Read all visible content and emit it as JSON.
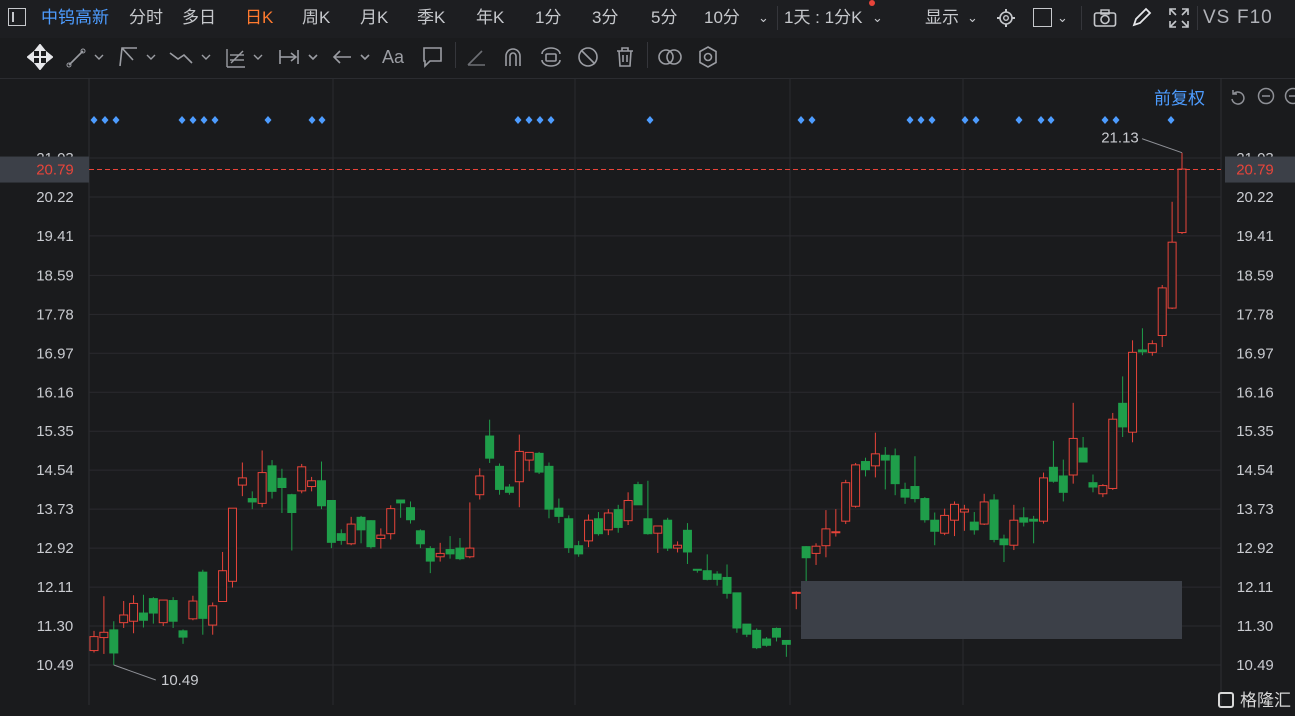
{
  "header": {
    "stock_name": "中钨高新",
    "period_tabs": [
      "分时",
      "多日",
      "日K",
      "周K",
      "月K",
      "季K",
      "年K",
      "1分",
      "3分",
      "5分",
      "10分"
    ],
    "active_tab": "日K",
    "period_select": "1天 : 1分K",
    "display_label": "显示",
    "vs_label": "VS",
    "f10_label": "F10"
  },
  "chart_header": {
    "adjust_label": "前复权"
  },
  "colors": {
    "up": "#e8443a",
    "down": "#1f9e4a",
    "active_tab": "#ff7a2f",
    "accent_blue": "#4d9cff",
    "price_line": "#e8443a"
  },
  "chart_data": {
    "type": "candlestick",
    "y_ticks": [
      "21.03",
      "20.22",
      "19.41",
      "18.59",
      "17.78",
      "16.97",
      "16.16",
      "15.35",
      "14.54",
      "13.73",
      "12.92",
      "12.11",
      "11.30",
      "10.49"
    ],
    "ylim": [
      10.49,
      21.03
    ],
    "current_price": "20.79",
    "high_label": "21.13",
    "low_label": "10.49",
    "candles": [
      [
        10.79,
        11.08,
        10.75,
        11.2
      ],
      [
        11.06,
        11.17,
        10.72,
        11.92
      ],
      [
        11.22,
        10.74,
        10.49,
        11.4
      ],
      [
        11.37,
        11.53,
        11.26,
        11.82
      ],
      [
        11.4,
        11.77,
        11.15,
        11.94
      ],
      [
        11.57,
        11.42,
        11.27,
        11.95
      ],
      [
        11.87,
        11.57,
        11.35,
        11.9
      ],
      [
        11.37,
        11.84,
        11.3,
        11.84
      ],
      [
        11.83,
        11.4,
        11.26,
        11.9
      ],
      [
        11.2,
        11.07,
        10.93,
        11.23
      ],
      [
        11.45,
        11.82,
        11.42,
        11.93
      ],
      [
        12.42,
        11.46,
        11.12,
        12.47
      ],
      [
        11.32,
        11.72,
        11.12,
        11.79
      ],
      [
        11.81,
        12.45,
        11.81,
        12.84
      ],
      [
        12.23,
        13.75,
        12.1,
        13.75
      ],
      [
        14.23,
        14.38,
        14.0,
        14.7
      ],
      [
        13.95,
        13.88,
        13.73,
        14.1
      ],
      [
        13.85,
        14.49,
        13.77,
        14.95
      ],
      [
        14.63,
        14.1,
        13.95,
        14.75
      ],
      [
        14.37,
        14.18,
        13.65,
        14.57
      ],
      [
        14.03,
        13.66,
        12.87,
        14.05
      ],
      [
        14.11,
        14.61,
        14.06,
        14.67
      ],
      [
        14.2,
        14.32,
        14.1,
        14.4
      ],
      [
        14.32,
        13.8,
        13.73,
        14.72
      ],
      [
        13.91,
        13.04,
        12.92,
        13.92
      ],
      [
        13.22,
        13.08,
        12.99,
        13.31
      ],
      [
        13.01,
        13.42,
        12.98,
        13.57
      ],
      [
        13.56,
        13.3,
        13.02,
        13.59
      ],
      [
        13.49,
        12.95,
        12.91,
        13.5
      ],
      [
        13.12,
        13.19,
        12.91,
        13.33
      ],
      [
        13.22,
        13.74,
        13.1,
        13.81
      ],
      [
        13.92,
        13.86,
        13.55,
        13.92
      ],
      [
        13.76,
        13.51,
        13.43,
        13.89
      ],
      [
        13.28,
        13.01,
        12.92,
        13.31
      ],
      [
        12.91,
        12.65,
        12.4,
        12.96
      ],
      [
        12.74,
        12.81,
        12.64,
        13.03
      ],
      [
        12.89,
        12.8,
        12.7,
        13.17
      ],
      [
        12.92,
        12.7,
        12.67,
        13.13
      ],
      [
        12.74,
        12.92,
        12.71,
        13.87
      ],
      [
        14.03,
        14.42,
        13.93,
        14.58
      ],
      [
        15.25,
        14.79,
        14.69,
        15.59
      ],
      [
        14.62,
        14.14,
        14.03,
        14.68
      ],
      [
        14.19,
        14.08,
        14.03,
        14.25
      ],
      [
        14.3,
        14.93,
        13.77,
        15.28
      ],
      [
        14.75,
        14.91,
        14.52,
        14.91
      ],
      [
        14.89,
        14.5,
        14.46,
        14.92
      ],
      [
        14.62,
        13.73,
        13.54,
        14.7
      ],
      [
        13.75,
        13.58,
        13.44,
        13.95
      ],
      [
        13.53,
        12.93,
        12.82,
        13.6
      ],
      [
        12.97,
        12.8,
        12.74,
        13.07
      ],
      [
        13.07,
        13.5,
        12.94,
        13.62
      ],
      [
        13.53,
        13.22,
        13.18,
        13.67
      ],
      [
        13.3,
        13.65,
        13.19,
        13.73
      ],
      [
        13.72,
        13.35,
        13.24,
        13.82
      ],
      [
        13.49,
        13.91,
        13.4,
        14.08
      ],
      [
        14.24,
        13.82,
        13.82,
        14.3
      ],
      [
        13.53,
        13.22,
        13.2,
        14.32
      ],
      [
        13.23,
        13.38,
        12.82,
        13.39
      ],
      [
        13.5,
        12.92,
        12.86,
        13.55
      ],
      [
        12.92,
        12.98,
        12.83,
        13.06
      ],
      [
        13.29,
        12.84,
        12.59,
        13.44
      ],
      [
        12.48,
        12.46,
        12.41,
        12.47
      ],
      [
        12.45,
        12.27,
        12.25,
        12.79
      ],
      [
        12.38,
        12.27,
        12.14,
        12.44
      ],
      [
        12.31,
        11.98,
        11.87,
        12.58
      ],
      [
        11.99,
        11.26,
        11.16,
        11.99
      ],
      [
        11.34,
        11.13,
        11.07,
        11.29
      ],
      [
        11.21,
        10.85,
        10.82,
        11.25
      ],
      [
        11.03,
        10.9,
        10.87,
        11.07
      ],
      [
        11.25,
        11.07,
        10.98,
        11.27
      ],
      [
        11.0,
        10.92,
        10.66,
        11.01
      ],
      [
        11.98,
        12.0,
        11.65,
        12.02
      ],
      [
        12.95,
        12.72,
        12.23,
        12.96
      ],
      [
        12.81,
        12.96,
        12.57,
        13.02
      ],
      [
        12.97,
        13.32,
        12.73,
        13.71
      ],
      [
        13.24,
        13.26,
        13.16,
        13.73
      ],
      [
        13.48,
        14.28,
        13.42,
        14.34
      ],
      [
        13.79,
        14.65,
        13.76,
        14.69
      ],
      [
        14.72,
        14.55,
        14.41,
        14.8
      ],
      [
        14.63,
        14.88,
        14.39,
        15.32
      ],
      [
        14.85,
        14.75,
        14.14,
        15.02
      ],
      [
        14.84,
        14.26,
        14.02,
        14.99
      ],
      [
        14.14,
        13.98,
        13.84,
        14.28
      ],
      [
        14.2,
        13.95,
        13.87,
        14.83
      ],
      [
        13.95,
        13.51,
        13.45,
        13.98
      ],
      [
        13.5,
        13.27,
        12.98,
        13.66
      ],
      [
        13.23,
        13.6,
        13.19,
        13.74
      ],
      [
        13.5,
        13.83,
        13.17,
        13.89
      ],
      [
        13.67,
        13.73,
        13.28,
        13.82
      ],
      [
        13.46,
        13.3,
        13.2,
        13.67
      ],
      [
        13.42,
        13.88,
        13.4,
        14.05
      ],
      [
        13.92,
        13.1,
        13.04,
        14.04
      ],
      [
        13.11,
        12.99,
        12.63,
        13.2
      ],
      [
        12.98,
        13.5,
        12.88,
        13.82
      ],
      [
        13.55,
        13.46,
        13.37,
        13.77
      ],
      [
        13.52,
        13.48,
        13.02,
        13.59
      ],
      [
        13.48,
        14.38,
        13.43,
        14.49
      ],
      [
        14.6,
        14.31,
        14.28,
        15.15
      ],
      [
        14.42,
        14.08,
        13.89,
        14.76
      ],
      [
        14.44,
        15.2,
        14.26,
        15.94
      ],
      [
        15.0,
        14.71,
        14.7,
        15.23
      ],
      [
        14.28,
        14.19,
        14.08,
        14.45
      ],
      [
        14.05,
        14.22,
        13.98,
        14.25
      ],
      [
        14.16,
        15.6,
        14.13,
        15.73
      ],
      [
        15.93,
        15.44,
        15.23,
        16.49
      ],
      [
        15.33,
        16.99,
        15.12,
        17.24
      ],
      [
        17.04,
        17.0,
        16.93,
        17.49
      ],
      [
        16.99,
        17.17,
        16.92,
        17.24
      ],
      [
        17.34,
        18.33,
        17.1,
        18.39
      ],
      [
        17.91,
        19.28,
        17.89,
        20.12
      ],
      [
        19.48,
        20.8,
        19.45,
        21.14
      ]
    ]
  }
}
